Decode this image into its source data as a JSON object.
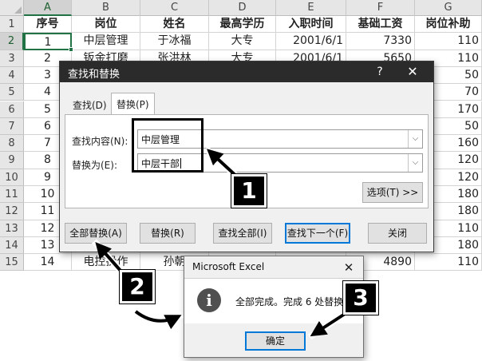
{
  "sheet": {
    "corner_icon": "select-all-triangle-icon",
    "columns": [
      "A",
      "B",
      "C",
      "D",
      "E",
      "F",
      "G"
    ],
    "rows": [
      "1",
      "2",
      "3",
      "4",
      "5",
      "6",
      "7",
      "8",
      "9",
      "10",
      "11",
      "12",
      "13",
      "14",
      "15"
    ],
    "header": [
      "序号",
      "岗位",
      "姓名",
      "最高学历",
      "入职时间",
      "基础工资",
      "岗位补助"
    ],
    "data": [
      [
        "1",
        "中层管理",
        "于冰福",
        "大专",
        "2001/6/1",
        "7330",
        "110"
      ],
      [
        "2",
        "钣金打磨",
        "张洪林",
        "大专",
        "2001/6/1",
        "5650",
        "110"
      ],
      [
        "3",
        "",
        "",
        "",
        "",
        "",
        "50"
      ],
      [
        "4",
        "",
        "",
        "",
        "",
        "",
        "70"
      ],
      [
        "5",
        "",
        "",
        "",
        "",
        "",
        "170"
      ],
      [
        "6",
        "",
        "",
        "",
        "",
        "",
        "50"
      ],
      [
        "7",
        "",
        "",
        "",
        "",
        "",
        "160"
      ],
      [
        "8",
        "",
        "",
        "",
        "",
        "",
        "120"
      ],
      [
        "9",
        "",
        "",
        "",
        "",
        "",
        "120"
      ],
      [
        "10",
        "",
        "",
        "",
        "",
        "",
        "180"
      ],
      [
        "11",
        "",
        "",
        "",
        "",
        "",
        "180"
      ],
      [
        "12",
        "",
        "",
        "",
        "",
        "",
        "110"
      ],
      [
        "13",
        "",
        "",
        "",
        "",
        "",
        "180"
      ],
      [
        "14",
        "电控操作",
        "孙朝",
        "",
        "",
        "4890",
        "110"
      ]
    ]
  },
  "find_replace": {
    "title": "查找和替换",
    "help": "?",
    "close": "✕",
    "tabs": [
      "查找(D)",
      "替换(P)"
    ],
    "find_label": "查找内容(N):",
    "find_value": "中层管理",
    "replace_label": "替换为(E):",
    "replace_value": "中层干部",
    "dropdown_icon": "chevron-down-icon",
    "options_button": "选项(T) >>",
    "buttons": {
      "replace_all": "全部替换(A)",
      "replace": "替换(R)",
      "find_all": "查找全部(I)",
      "find_next": "查找下一个(F)",
      "close": "关闭"
    }
  },
  "message_box": {
    "title": "Microsoft Excel",
    "close": "✕",
    "icon": "info-icon",
    "icon_glyph": "i",
    "text": "全部完成。完成 6 处替换。",
    "ok_button": "确定"
  },
  "annotations": {
    "step1": "1",
    "step2": "2",
    "step3": "3",
    "highlight_color": "#000000"
  },
  "colors": {
    "excel_green": "#217346",
    "dialog_title_bg": "#2b2b2b",
    "focus_blue": "#0078d7"
  }
}
